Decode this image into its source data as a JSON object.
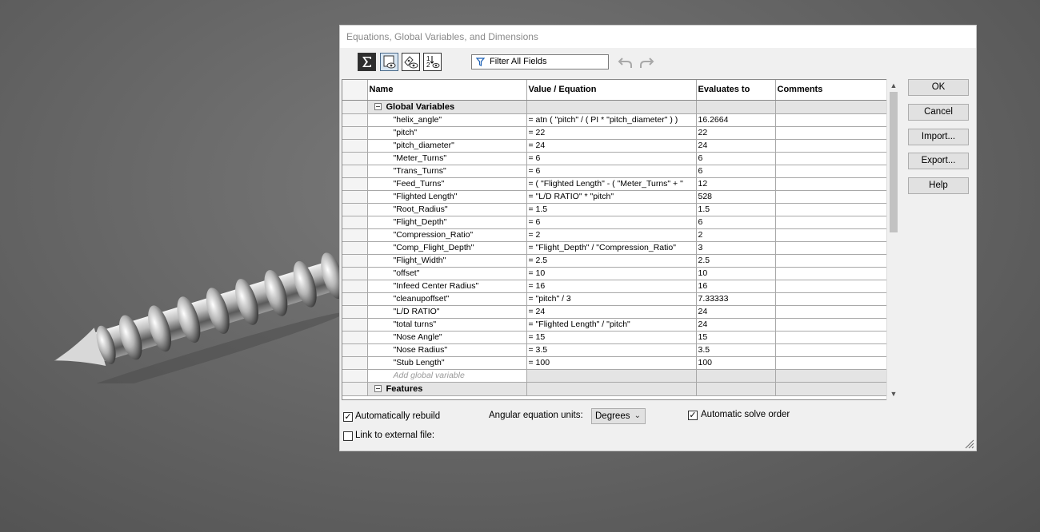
{
  "dialog": {
    "title": "Equations, Global Variables, and Dimensions",
    "filter_placeholder": "Filter All Fields"
  },
  "table": {
    "headers": [
      "Name",
      "Value / Equation",
      "Evaluates to",
      "Comments"
    ],
    "group_global": "Global Variables",
    "group_features": "Features",
    "add_placeholder": "Add global variable",
    "rows": [
      {
        "name": "\"helix_angle\"",
        "value": "= atn ( \"pitch\" / ( PI * \"pitch_diameter\" ) )",
        "eval": "16.2664"
      },
      {
        "name": "\"pitch\"",
        "value": "= 22",
        "eval": "22"
      },
      {
        "name": "\"pitch_diameter\"",
        "value": "= 24",
        "eval": "24"
      },
      {
        "name": "\"Meter_Turns\"",
        "value": "= 6",
        "eval": "6"
      },
      {
        "name": "\"Trans_Turns\"",
        "value": "= 6",
        "eval": "6"
      },
      {
        "name": "\"Feed_Turns\"",
        "value": "= ( \"Flighted Length\" - ( \"Meter_Turns\" + \"",
        "eval": "12"
      },
      {
        "name": "\"Flighted Length\"",
        "value": "= \"L/D RATIO\" * \"pitch\"",
        "eval": "528"
      },
      {
        "name": "\"Root_Radius\"",
        "value": "= 1.5",
        "eval": "1.5"
      },
      {
        "name": "\"Flight_Depth\"",
        "value": "= 6",
        "eval": "6"
      },
      {
        "name": "\"Compression_Ratio\"",
        "value": "= 2",
        "eval": "2"
      },
      {
        "name": "\"Comp_Flight_Depth\"",
        "value": "= \"Flight_Depth\" / \"Compression_Ratio\"",
        "eval": "3"
      },
      {
        "name": "\"Flight_Width\"",
        "value": "= 2.5",
        "eval": "2.5"
      },
      {
        "name": "\"offset\"",
        "value": "= 10",
        "eval": "10"
      },
      {
        "name": "\"Infeed Center Radius\"",
        "value": "= 16",
        "eval": "16"
      },
      {
        "name": "\"cleanupoffset\"",
        "value": "= \"pitch\" / 3",
        "eval": "7.33333"
      },
      {
        "name": "\"L/D RATIO\"",
        "value": "= 24",
        "eval": "24"
      },
      {
        "name": "\"total turns\"",
        "value": "= \"Flighted Length\" / \"pitch\"",
        "eval": "24"
      },
      {
        "name": "\"Nose Angle\"",
        "value": "= 15",
        "eval": "15"
      },
      {
        "name": "\"Nose Radius\"",
        "value": "= 3.5",
        "eval": "3.5"
      },
      {
        "name": "\"Stub Length\"",
        "value": "= 100",
        "eval": "100"
      }
    ]
  },
  "buttons": {
    "ok": "OK",
    "cancel": "Cancel",
    "import": "Import...",
    "export": "Export...",
    "help": "Help"
  },
  "footer": {
    "auto_rebuild": "Automatically rebuild",
    "link_external": "Link to external file:",
    "angular_units_label": "Angular equation units:",
    "angular_units_value": "Degrees",
    "auto_solve": "Automatic solve order"
  }
}
